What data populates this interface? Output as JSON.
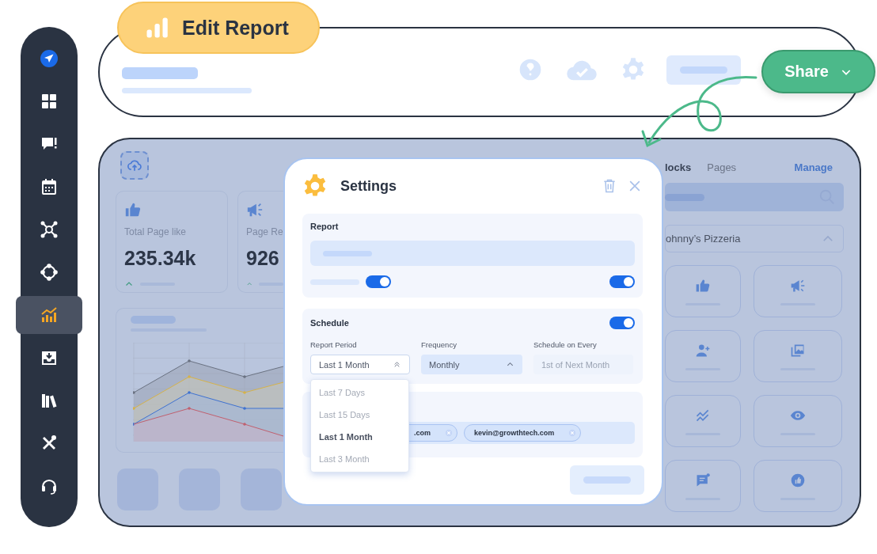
{
  "sidebar": {
    "items": [
      {
        "kind": "plane",
        "selected": false
      },
      {
        "kind": "grid",
        "selected": false
      },
      {
        "kind": "feedback",
        "selected": false
      },
      {
        "kind": "calendar",
        "selected": false
      },
      {
        "kind": "network",
        "selected": false
      },
      {
        "kind": "nodes",
        "selected": false
      },
      {
        "kind": "chart",
        "selected": true
      },
      {
        "kind": "inbox",
        "selected": false
      },
      {
        "kind": "books",
        "selected": false
      },
      {
        "kind": "tools",
        "selected": false
      },
      {
        "kind": "headset",
        "selected": false
      }
    ]
  },
  "top_bar": {
    "badge": "Edit Report",
    "share_button": "Share"
  },
  "dashboard": {
    "stat_cards": [
      {
        "kind": "like",
        "label": "Total Page like",
        "value": "235.34k"
      },
      {
        "kind": "megaphone",
        "label": "Page Re",
        "value": "926"
      }
    ]
  },
  "blocks_panel": {
    "tabs": [
      {
        "label": "locks",
        "selected": true
      },
      {
        "label": "Pages",
        "selected": false
      }
    ],
    "manage_link": "Manage",
    "page_dropdown": "ohnny’s Pizzeria",
    "blocks": [
      {
        "kind": "like"
      },
      {
        "kind": "megaphone"
      },
      {
        "kind": "add-user"
      },
      {
        "kind": "gallery"
      },
      {
        "kind": "trend"
      },
      {
        "kind": "eye"
      },
      {
        "kind": "comment"
      },
      {
        "kind": "thumb-circle"
      }
    ]
  },
  "settings": {
    "title": "Settings",
    "report": {
      "title": "Report",
      "toggles": [
        {
          "on": true
        },
        {
          "on": true
        }
      ]
    },
    "schedule": {
      "title": "Schedule",
      "on": true,
      "report_period": {
        "label": "Report Period",
        "value": "Last 1 Month",
        "options": [
          {
            "label": "Last 7 Days",
            "selected": false
          },
          {
            "label": "Last 15 Days",
            "selected": false
          },
          {
            "label": "Last 1 Month",
            "selected": true
          },
          {
            "label": "Last 3 Month",
            "selected": false
          }
        ]
      },
      "frequency": {
        "label": "Frequency",
        "value": "Monthly"
      },
      "schedule_on": {
        "label": "Schedule on Every",
        "placeholder": "1st of Next Month"
      }
    },
    "recipients": {
      "chips": [
        ".com",
        "kevin@growthtech.com"
      ]
    }
  }
}
